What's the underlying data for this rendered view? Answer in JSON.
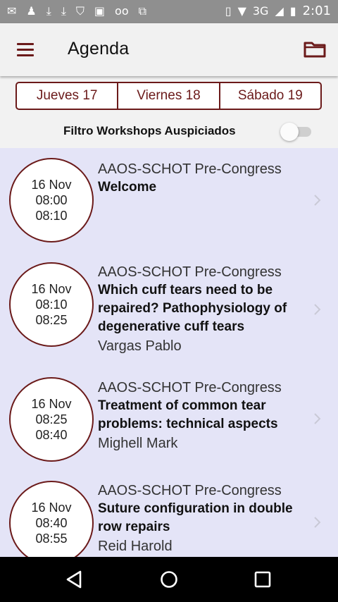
{
  "status_bar": {
    "left_icons": [
      "mail-icon",
      "person-icon",
      "download-icon",
      "download-icon",
      "shield-icon",
      "image-icon",
      "voicemail-icon",
      "work-icon"
    ],
    "network": "3G",
    "time": "2:01"
  },
  "app_bar": {
    "title": "Agenda",
    "menu_icon": "hamburger-menu-icon",
    "folder_icon": "folder-icon"
  },
  "day_tabs": [
    {
      "label": "Jueves 17"
    },
    {
      "label": "Viernes 18"
    },
    {
      "label": "Sábado 19"
    }
  ],
  "filter": {
    "label": "Filtro Workshops Auspiciados",
    "enabled": false
  },
  "sessions": [
    {
      "date": "16 Nov",
      "start": "08:00",
      "end": "08:10",
      "category": "AAOS-SCHOT Pre-Congress",
      "title": "Welcome",
      "speaker": ""
    },
    {
      "date": "16 Nov",
      "start": "08:10",
      "end": "08:25",
      "category": "AAOS-SCHOT Pre-Congress",
      "title": "Which cuff tears need to be repaired? Pathophysiology of degenerative cuff tears",
      "speaker": "Vargas Pablo"
    },
    {
      "date": "16 Nov",
      "start": "08:25",
      "end": "08:40",
      "category": "AAOS-SCHOT Pre-Congress",
      "title": "Treatment of common tear problems: technical aspects",
      "speaker": "Mighell Mark"
    },
    {
      "date": "16 Nov",
      "start": "08:40",
      "end": "08:55",
      "category": "AAOS-SCHOT Pre-Congress",
      "title": "Suture configuration in double row repairs",
      "speaker": "Reid Harold"
    }
  ],
  "colors": {
    "accent": "#6b1a1a",
    "list_background": "#e4e4f7",
    "app_bar": "#f1f1f1",
    "status_bar": "#8f8f8f",
    "nav_bar": "#000000"
  },
  "nav_bar": [
    "back-icon",
    "home-icon",
    "recents-icon"
  ]
}
